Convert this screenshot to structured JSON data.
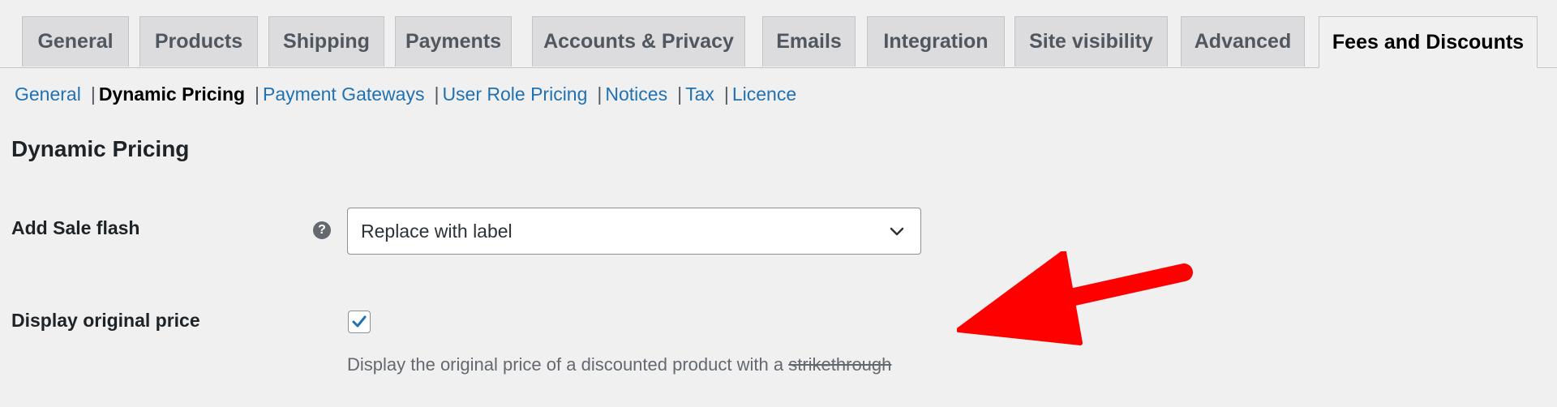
{
  "tabs": [
    {
      "label": "General",
      "active": false
    },
    {
      "label": "Products",
      "active": false
    },
    {
      "label": "Shipping",
      "active": false
    },
    {
      "label": "Payments",
      "active": false
    },
    {
      "label": "Accounts & Privacy",
      "active": false
    },
    {
      "label": "Emails",
      "active": false
    },
    {
      "label": "Integration",
      "active": false
    },
    {
      "label": "Site visibility",
      "active": false
    },
    {
      "label": "Advanced",
      "active": false
    },
    {
      "label": "Fees and Discounts",
      "active": true
    }
  ],
  "subnav": {
    "items": [
      {
        "label": "General",
        "current": false
      },
      {
        "label": "Dynamic Pricing",
        "current": true
      },
      {
        "label": "Payment Gateways",
        "current": false
      },
      {
        "label": "User Role Pricing",
        "current": false
      },
      {
        "label": "Notices",
        "current": false
      },
      {
        "label": "Tax",
        "current": false
      },
      {
        "label": "Licence",
        "current": false
      }
    ],
    "separator": "|"
  },
  "section": {
    "title": "Dynamic Pricing"
  },
  "fields": {
    "sale_flash": {
      "label": "Add Sale flash",
      "help_icon": "question-circle-icon",
      "selected": "Replace with label"
    },
    "original_price": {
      "label": "Display original price",
      "checked": true,
      "description": "Display the original price of a discounted product with a",
      "description_strike": "strikethrough"
    }
  },
  "colors": {
    "accent": "#2271b1",
    "background": "#f0f0f1",
    "annotation_arrow": "#ff0000"
  }
}
